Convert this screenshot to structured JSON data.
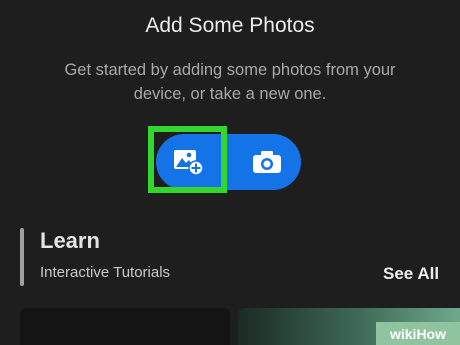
{
  "empty_state": {
    "title": "Add Some Photos",
    "subtitle": "Get started by adding some photos from your device, or take a new one."
  },
  "actions": {
    "add_photo_icon": "add-photo-icon",
    "camera_icon": "camera-icon",
    "accent_color": "#1473e6",
    "highlight_color": "#32d62c"
  },
  "learn": {
    "heading": "Learn",
    "subtitle": "Interactive Tutorials",
    "see_all": "See All"
  },
  "watermark": {
    "text": "wikiHow"
  }
}
